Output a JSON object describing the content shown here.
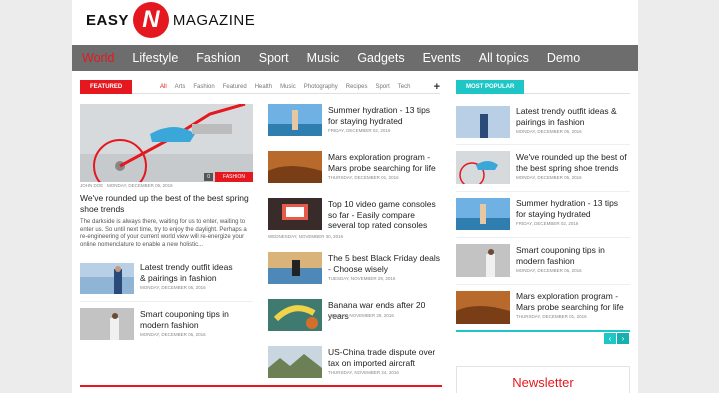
{
  "logo": {
    "part1": "EASY",
    "mark": "N",
    "part2": "MAGAZINE"
  },
  "nav": [
    "World",
    "Lifestyle",
    "Fashion",
    "Sport",
    "Music",
    "Gadgets",
    "Events",
    "All topics",
    "Demo"
  ],
  "featured": {
    "label": "FEATURED",
    "filters": [
      "All",
      "Arts",
      "Fashion",
      "Featured",
      "Health",
      "Music",
      "Photography",
      "Recipes",
      "Sport",
      "Tech"
    ],
    "plus": "+"
  },
  "hero": {
    "category": "FASHION",
    "comments": "0",
    "author": "JOHN DOE",
    "date": "MONDAY, DECEMBER 05, 2016",
    "title": "We've rounded up the best of the best spring shoe trends",
    "excerpt": "The darkside is always there, waiting for us to enter, waiting to enter us. So until next time, try to enjoy the daylight. Perhaps a re-engineering of your current world view will re-energize your online nomenclature to enable a new holistic..."
  },
  "left_list": [
    {
      "title": "Latest trendy outfit ideas & pairings in fashion",
      "date": "MONDAY, DECEMBER 05, 2016"
    },
    {
      "title": "Smart couponing tips in modern fashion",
      "date": "MONDAY, DECEMBER 05, 2016"
    }
  ],
  "mid_list": [
    {
      "title": "Summer hydration - 13 tips for staying hydrated",
      "date": "FRIDAY, DECEMBER 02, 2016"
    },
    {
      "title": "Mars exploration program - Mars probe searching for life",
      "date": "THURSDAY, DECEMBER 01, 2016"
    },
    {
      "title": "Top 10 video game consoles so far - Easily compare several top rated consoles",
      "date": "WEDNESDAY, NOVEMBER 30, 2016"
    },
    {
      "title": "The 5 best Black Friday deals - Choose wisely",
      "date": "TUESDAY, NOVEMBER 29, 2016"
    },
    {
      "title": "Banana war ends after 20 years",
      "date": "MONDAY, NOVEMBER 28, 2016"
    },
    {
      "title": "US-China trade dispute over tax on imported aircraft",
      "date": "THURSDAY, NOVEMBER 24, 2016"
    }
  ],
  "popular": {
    "label": "MOST POPULAR",
    "items": [
      {
        "title": "Latest trendy outfit ideas & pairings in fashion",
        "date": "MONDAY, DECEMBER 05, 2016"
      },
      {
        "title": "We've rounded up the best of the best spring shoe trends",
        "date": "MONDAY, DECEMBER 05, 2016"
      },
      {
        "title": "Summer hydration - 13 tips for staying hydrated",
        "date": "FRIDAY, DECEMBER 02, 2016"
      },
      {
        "title": "Smart couponing tips in modern fashion",
        "date": "MONDAY, DECEMBER 05, 2016"
      },
      {
        "title": "Mars exploration program - Mars probe searching for life",
        "date": "THURSDAY, DECEMBER 01, 2016"
      }
    ],
    "prev": "‹",
    "next": "›"
  },
  "newsletter": "Newsletter",
  "colors": {
    "accent": "#e4181e",
    "teal": "#1ec6c6",
    "nav": "#6d6d6d"
  }
}
